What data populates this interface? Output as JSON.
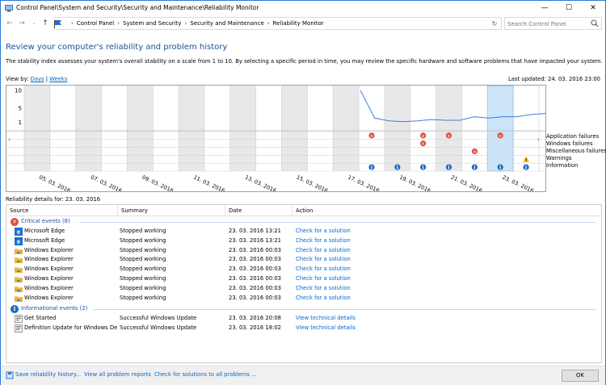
{
  "window": {
    "title": "Control Panel\\System and Security\\Security and Maintenance\\Reliability Monitor",
    "min": "—",
    "max": "☐",
    "close": "✕"
  },
  "address": {
    "crumbs": [
      "Control Panel",
      "System and Security",
      "Security and Maintenance",
      "Reliability Monitor"
    ],
    "search_placeholder": "Search Control Panel"
  },
  "page": {
    "heading": "Review your computer's reliability and problem history",
    "description": "The stability index assesses your system's overall stability on a scale from 1 to 10. By selecting a specific period in time, you may review the specific hardware and software problems that have impacted your system.",
    "view_by": "View by:",
    "days": "Days",
    "sep": "|",
    "weeks": "Weeks",
    "last_updated": "Last updated: 24. 03. 2016 23:00",
    "details_label": "Reliability details for: 23. 03. 2016"
  },
  "chart_data": {
    "type": "line",
    "y_ticks": [
      "10",
      "5",
      "1"
    ],
    "ylim": [
      0,
      10
    ],
    "x_labels": [
      "05. 03. 2016",
      "07. 03. 2016",
      "09. 03. 2016",
      "11. 03. 2016",
      "13. 03. 2016",
      "15. 03. 2016",
      "17. 03. 2016",
      "19. 03. 2016",
      "21. 03. 2016",
      "23. 03. 2016"
    ],
    "row_labels": [
      "Application failures",
      "Windows failures",
      "Miscellaneous failures",
      "Warnings",
      "Information"
    ],
    "stability_index": [
      10,
      2.2,
      1.4,
      1.2,
      1.4,
      1.8,
      1.6,
      1.6,
      2.6,
      2.2,
      2.6,
      2.6,
      3.2,
      3.5
    ],
    "selected_date": "23. 03. 2016"
  },
  "grid": {
    "headers": [
      "Source",
      "Summary",
      "Date",
      "Action"
    ],
    "groups": [
      {
        "label": "Critical events (8)",
        "rows": [
          {
            "source": "Microsoft Edge",
            "summary": "Stopped working",
            "date": "23. 03. 2016 13:21",
            "action": "Check for a solution",
            "icon": "edge-icon"
          },
          {
            "source": "Microsoft Edge",
            "summary": "Stopped working",
            "date": "23. 03. 2016 13:21",
            "action": "Check for a solution",
            "icon": "edge-icon"
          },
          {
            "source": "Windows Explorer",
            "summary": "Stopped working",
            "date": "23. 03. 2016 00:03",
            "action": "Check for a solution",
            "icon": "folder-icon"
          },
          {
            "source": "Windows Explorer",
            "summary": "Stopped working",
            "date": "23. 03. 2016 00:03",
            "action": "Check for a solution",
            "icon": "folder-icon"
          },
          {
            "source": "Windows Explorer",
            "summary": "Stopped working",
            "date": "23. 03. 2016 00:03",
            "action": "Check for a solution",
            "icon": "folder-icon"
          },
          {
            "source": "Windows Explorer",
            "summary": "Stopped working",
            "date": "23. 03. 2016 00:03",
            "action": "Check for a solution",
            "icon": "folder-icon"
          },
          {
            "source": "Windows Explorer",
            "summary": "Stopped working",
            "date": "23. 03. 2016 00:03",
            "action": "Check for a solution",
            "icon": "folder-icon"
          },
          {
            "source": "Windows Explorer",
            "summary": "Stopped working",
            "date": "23. 03. 2016 00:03",
            "action": "Check for a solution",
            "icon": "folder-icon"
          }
        ]
      },
      {
        "label": "Informational events (2)",
        "rows": [
          {
            "source": "Get Started",
            "summary": "Successful Windows Update",
            "date": "23. 03. 2016 20:08",
            "action": "View  technical details",
            "icon": "update-icon"
          },
          {
            "source": "Definition Update for Windows De...",
            "summary": "Successful Windows Update",
            "date": "23. 03. 2016 18:02",
            "action": "View  technical details",
            "icon": "update-icon"
          }
        ]
      }
    ]
  },
  "footer": {
    "save": "Save reliability history...",
    "view_all": "View all problem reports",
    "check_all": "Check for solutions to all problems ...",
    "ok": "OK"
  },
  "colors": {
    "accent": "#2b79d6",
    "error": "#e04b3a",
    "info": "#1c6bc6",
    "warn": "#f5c400",
    "line": "#3d7fe0"
  }
}
